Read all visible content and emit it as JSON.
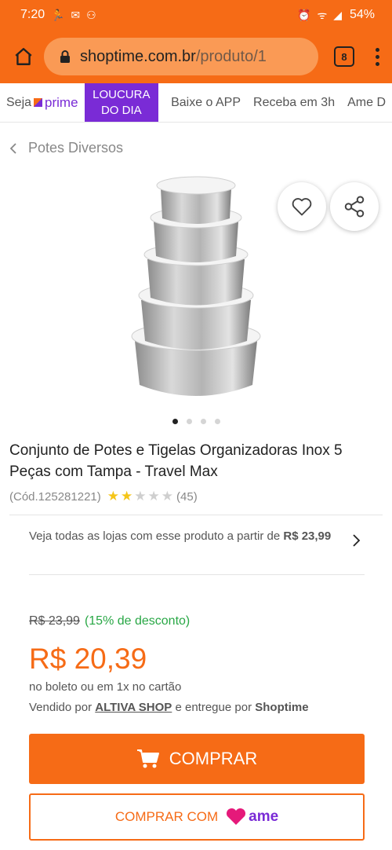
{
  "status_bar": {
    "time": "7:20",
    "notifications": "🏃 ✉ ⚇",
    "signal": "⏰ ᯤ ◢",
    "battery": "54%"
  },
  "browser": {
    "domain": "shoptime.com.br",
    "path": "/produto/1",
    "tab_count": "8"
  },
  "promo_nav": {
    "prime_prefix": "Seja",
    "prime_label": "prime",
    "loucura_line1": "LOUCURA",
    "loucura_line2": "DO DIA",
    "items": [
      "Baixe o APP",
      "Receba em 3h",
      "Ame D"
    ]
  },
  "breadcrumb": {
    "label": "Potes Diversos"
  },
  "product": {
    "title": "Conjunto de Potes e Tigelas Organizadoras Inox 5 Peças com Tampa - Travel Max",
    "code": "(Cód.125281221)",
    "rating_value": 2,
    "rating_max": 5,
    "review_count": "(45)",
    "image_dots": 4,
    "image_active": 1
  },
  "stores": {
    "text": "Veja todas as lojas com esse produto a partir de",
    "price": "R$ 23,99"
  },
  "pricing": {
    "old_price": "R$ 23,99",
    "discount": "(15% de desconto)",
    "price": "R$ 20,39",
    "payment_note": "no boleto ou em 1x no cartão",
    "sold_by_prefix": "Vendido por",
    "seller": "ALTIVA SHOP",
    "delivered_by": "e entregue por",
    "shipper": "Shoptime"
  },
  "actions": {
    "buy_label": "COMPRAR",
    "buy_ame_label": "COMPRAR COM",
    "ame_logo_text": "ame"
  },
  "colors": {
    "brand": "#f66b16",
    "prime_purple": "#7a2bd6",
    "discount_green": "#28a745"
  }
}
